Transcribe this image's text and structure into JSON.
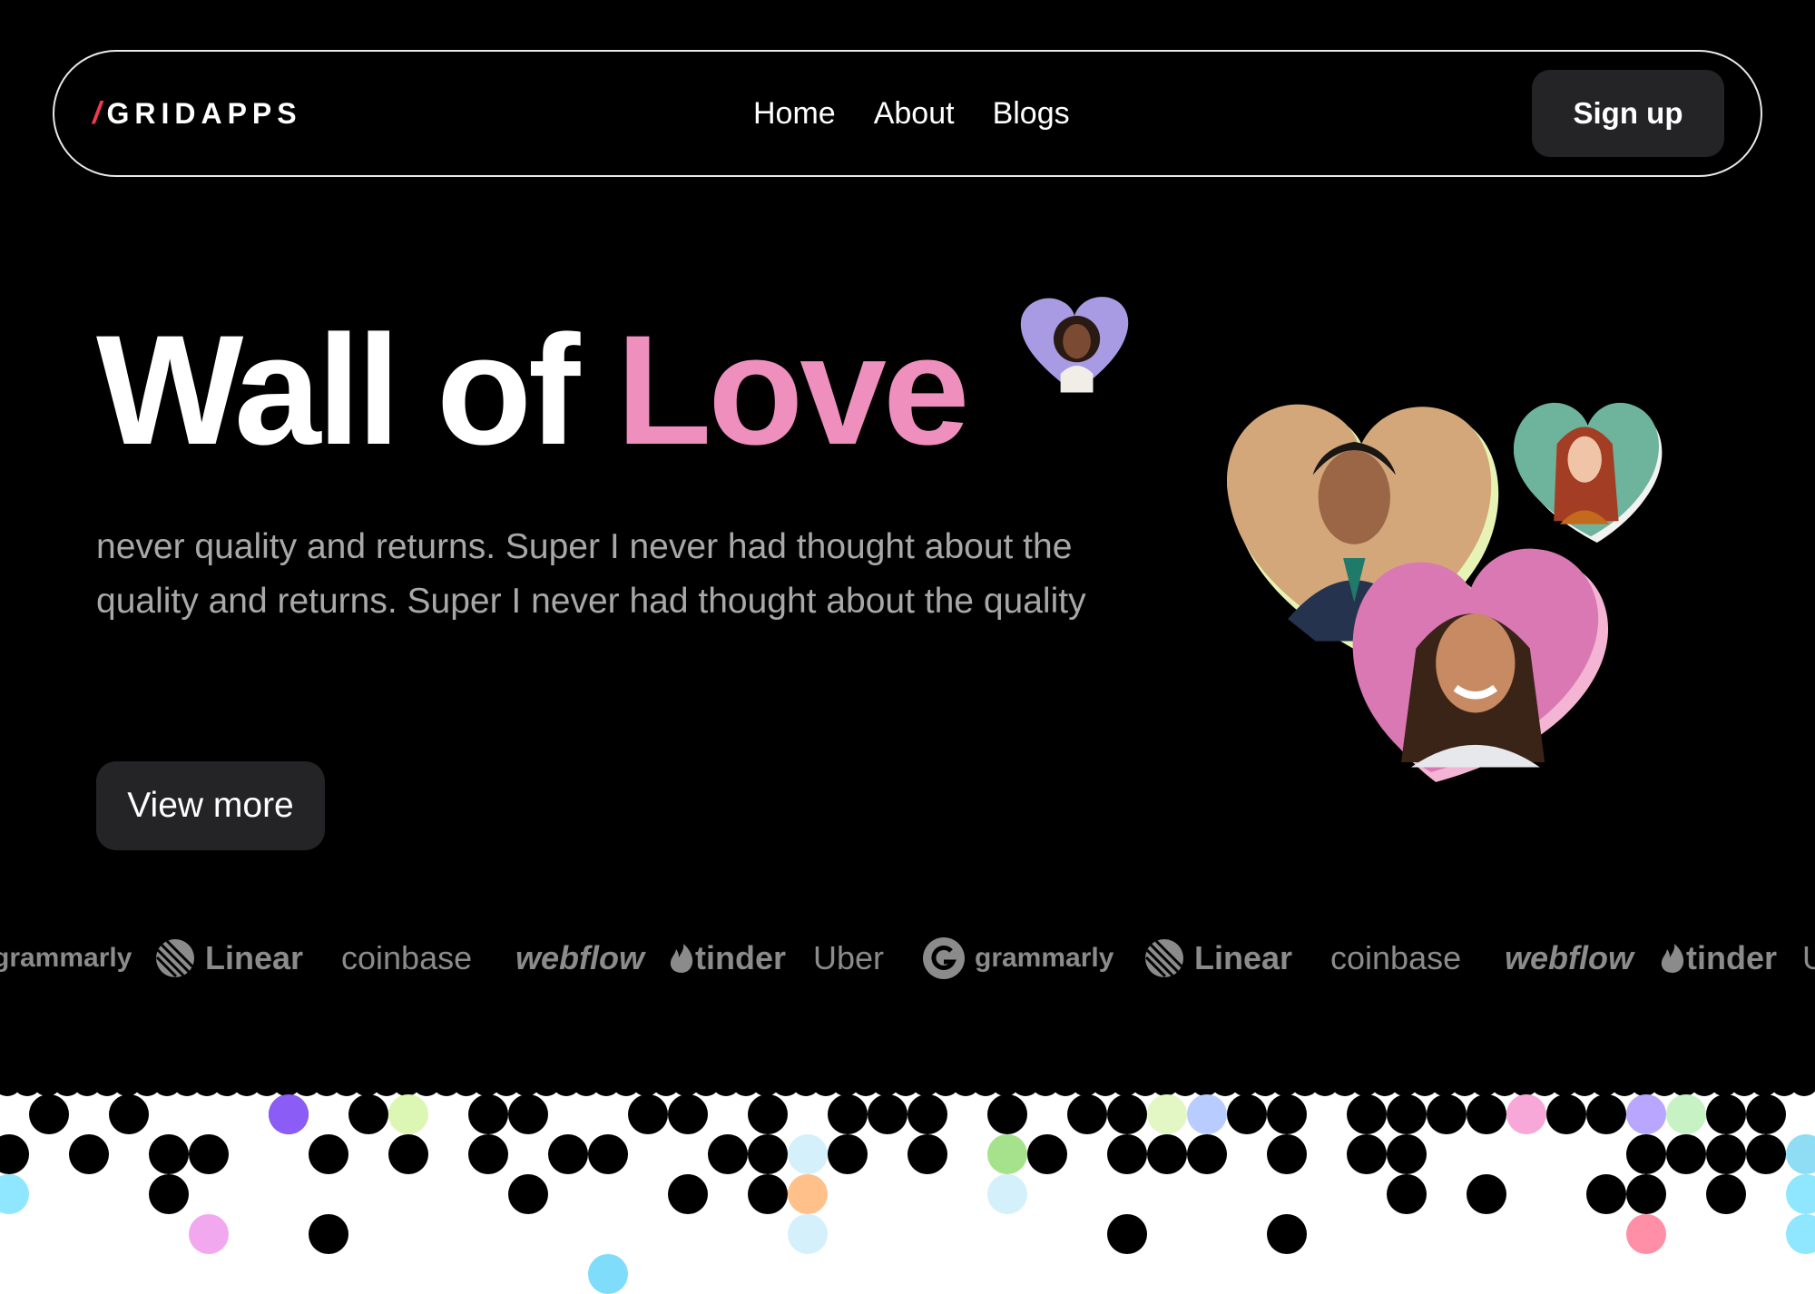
{
  "nav": {
    "brand_slash": "/",
    "brand_name": "GRIDAPPS",
    "links": [
      "Home",
      "About",
      "Blogs"
    ],
    "signup_label": "Sign up"
  },
  "hero": {
    "title_white": "Wall of",
    "title_pink": "Love",
    "description": "never  quality and returns. Super I never had thought about the quality and returns. Super I never had thought about the quality",
    "cta_label": "View more"
  },
  "logos": {
    "row": [
      "grammarly",
      "Linear",
      "coinbase",
      "webflow",
      "tinder",
      "Uber",
      "grammarly",
      "Linear",
      "coinbase",
      "webflow",
      "tinder",
      "Uber"
    ]
  },
  "colors": {
    "accent_pink": "#ee8fbd",
    "brand_red": "#ef3b4e",
    "button_bg": "#242427",
    "muted_text": "#a8a8a8",
    "logo_gray": "#8b8b8b"
  },
  "icons": {
    "linear": "linear-logo-icon",
    "tinder": "flame-icon",
    "grammarly": "grammarly-g-icon"
  }
}
